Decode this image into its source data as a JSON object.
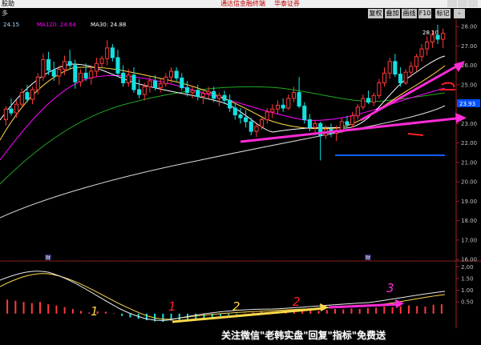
{
  "window": {
    "title_left": "股助",
    "title_center": "通达信金融终端",
    "title_brand": "华泰证券"
  },
  "toolbar": {
    "period_label": "多",
    "buttons": [
      "复权",
      "叠加",
      "画线",
      "F10",
      "标记",
      "-"
    ]
  },
  "ma_legend": [
    {
      "label": "24.15",
      "color": "#a9d8ff"
    },
    {
      "label": "MA120: 24.64",
      "color": "#ff00ff"
    },
    {
      "label": "MA30: 24.88",
      "color": "#ffffff"
    }
  ],
  "markers": {
    "top_price_label": "28.10",
    "current_price_tag": "23.93",
    "event_marker": "财"
  },
  "annotations": [
    "1",
    "1",
    "2",
    "2",
    "3"
  ],
  "watermark": "关注微信\"老韩实盘\"回复\"指标\"免费送",
  "chart_data": [
    {
      "type": "candlestick",
      "title": "",
      "y_ticks": [
        28.0,
        27.0,
        26.0,
        25.0,
        24.0,
        23.0,
        22.0,
        21.0,
        20.0,
        19.0,
        18.0,
        17.0,
        16.0
      ],
      "ylim": [
        15.92,
        28.38
      ],
      "grid": false,
      "candles": [
        [
          23.2,
          23.9,
          22.9,
          23.75
        ],
        [
          23.75,
          24.3,
          23.4,
          23.55
        ],
        [
          23.55,
          24.2,
          23.3,
          24.0
        ],
        [
          24.0,
          24.8,
          23.8,
          24.6
        ],
        [
          24.6,
          25.0,
          24.1,
          24.25
        ],
        [
          24.25,
          24.9,
          24.0,
          24.75
        ],
        [
          24.75,
          25.6,
          24.5,
          25.4
        ],
        [
          25.4,
          26.6,
          25.2,
          26.3
        ],
        [
          26.3,
          26.7,
          25.5,
          25.75
        ],
        [
          25.75,
          26.2,
          25.2,
          25.45
        ],
        [
          25.45,
          26.0,
          25.0,
          25.8
        ],
        [
          25.8,
          26.5,
          25.5,
          26.2
        ],
        [
          26.2,
          26.8,
          25.8,
          26.0
        ],
        [
          26.0,
          26.3,
          24.8,
          25.15
        ],
        [
          25.15,
          25.8,
          24.9,
          25.6
        ],
        [
          25.6,
          26.1,
          25.2,
          25.35
        ],
        [
          25.35,
          26.0,
          25.0,
          25.7
        ],
        [
          25.7,
          26.4,
          25.4,
          26.1
        ],
        [
          26.1,
          26.5,
          25.9,
          26.35
        ],
        [
          26.35,
          27.3,
          26.0,
          26.9
        ],
        [
          26.9,
          27.1,
          26.2,
          26.4
        ],
        [
          26.4,
          26.8,
          25.4,
          25.6
        ],
        [
          25.6,
          26.0,
          24.9,
          25.1
        ],
        [
          25.1,
          25.8,
          24.9,
          25.5
        ],
        [
          25.5,
          25.9,
          24.6,
          24.75
        ],
        [
          24.75,
          25.3,
          24.3,
          24.5
        ],
        [
          24.5,
          25.1,
          24.2,
          24.9
        ],
        [
          24.9,
          25.4,
          24.6,
          25.2
        ],
        [
          25.2,
          25.5,
          24.7,
          24.85
        ],
        [
          24.85,
          25.3,
          24.6,
          25.05
        ],
        [
          25.05,
          25.6,
          24.9,
          25.4
        ],
        [
          25.4,
          25.9,
          25.1,
          25.7
        ],
        [
          25.7,
          25.9,
          25.2,
          25.35
        ],
        [
          25.35,
          25.6,
          24.7,
          24.85
        ],
        [
          24.85,
          25.2,
          24.4,
          24.6
        ],
        [
          24.6,
          24.9,
          24.3,
          24.7
        ],
        [
          24.7,
          25.0,
          24.2,
          24.4
        ],
        [
          24.4,
          24.8,
          24.0,
          24.55
        ],
        [
          24.55,
          24.9,
          24.3,
          24.65
        ],
        [
          24.65,
          24.9,
          24.1,
          24.3
        ],
        [
          24.3,
          24.6,
          23.9,
          24.45
        ],
        [
          24.45,
          24.7,
          24.0,
          24.2
        ],
        [
          24.2,
          24.5,
          23.6,
          23.8
        ],
        [
          23.8,
          24.0,
          23.2,
          23.45
        ],
        [
          23.45,
          23.8,
          23.0,
          23.3
        ],
        [
          23.3,
          23.7,
          22.8,
          23.1
        ],
        [
          23.1,
          23.3,
          22.4,
          22.6
        ],
        [
          22.6,
          23.0,
          22.3,
          22.85
        ],
        [
          22.85,
          23.4,
          22.7,
          23.2
        ],
        [
          23.2,
          23.8,
          23.0,
          23.6
        ],
        [
          23.6,
          24.0,
          23.3,
          23.75
        ],
        [
          23.75,
          24.2,
          23.5,
          23.95
        ],
        [
          23.95,
          24.3,
          23.6,
          23.8
        ],
        [
          23.8,
          24.5,
          23.7,
          24.3
        ],
        [
          24.3,
          24.9,
          24.1,
          24.6
        ],
        [
          24.6,
          25.4,
          23.8,
          23.9
        ],
        [
          23.9,
          24.1,
          23.0,
          23.2
        ],
        [
          23.2,
          23.5,
          22.6,
          22.8
        ],
        [
          22.8,
          23.2,
          22.5,
          23.0
        ],
        [
          23.0,
          23.1,
          21.1,
          22.4
        ],
        [
          22.4,
          22.9,
          22.2,
          22.7
        ],
        [
          22.7,
          23.0,
          22.3,
          22.5
        ],
        [
          22.5,
          22.9,
          22.1,
          22.65
        ],
        [
          22.65,
          23.3,
          22.5,
          23.1
        ],
        [
          23.1,
          23.4,
          22.8,
          22.95
        ],
        [
          22.95,
          23.6,
          22.8,
          23.4
        ],
        [
          23.4,
          24.0,
          23.2,
          23.85
        ],
        [
          23.85,
          24.5,
          23.7,
          24.3
        ],
        [
          24.3,
          24.7,
          24.0,
          24.1
        ],
        [
          24.1,
          24.6,
          23.9,
          24.45
        ],
        [
          24.45,
          25.3,
          24.3,
          25.1
        ],
        [
          25.1,
          25.9,
          24.9,
          25.6
        ],
        [
          25.6,
          26.4,
          25.3,
          26.2
        ],
        [
          26.2,
          26.6,
          25.4,
          25.55
        ],
        [
          25.55,
          25.9,
          24.9,
          25.1
        ],
        [
          25.1,
          25.8,
          25.0,
          25.65
        ],
        [
          25.65,
          26.2,
          25.4,
          25.95
        ],
        [
          25.95,
          26.6,
          25.7,
          26.45
        ],
        [
          26.45,
          27.1,
          26.2,
          26.85
        ],
        [
          26.85,
          27.5,
          26.5,
          27.2
        ],
        [
          27.2,
          27.8,
          26.9,
          27.55
        ],
        [
          27.55,
          28.1,
          27.1,
          27.35
        ],
        [
          27.35,
          27.9,
          26.9,
          27.65
        ]
      ]
    },
    {
      "type": "bar",
      "title": "",
      "y_ticks": [
        2.0,
        1.5,
        1.0,
        0.5
      ],
      "ylim": [
        -0.62,
        2.18
      ],
      "grid": false,
      "series": [
        {
          "values": [
            0.6,
            0.55,
            0.5,
            0.45,
            0.5,
            0.4,
            0.35,
            0.28,
            0.2,
            0.12,
            0.05,
            0.1,
            0.08,
            0.02,
            -0.1,
            -0.16,
            -0.22,
            -0.28,
            -0.33,
            -0.35,
            -0.3,
            -0.28,
            -0.24,
            -0.22,
            -0.18,
            -0.14,
            -0.1,
            -0.06,
            -0.03,
            0.02,
            0.05,
            0.08,
            0.06,
            0.1,
            0.12,
            0.1,
            0.13,
            0.15,
            0.12,
            0.16,
            0.2,
            0.18,
            0.22,
            0.2,
            0.24,
            0.26,
            0.3,
            0.28,
            0.32,
            0.35,
            0.33,
            0.3,
            0.38,
            0.4
          ]
        }
      ]
    }
  ]
}
